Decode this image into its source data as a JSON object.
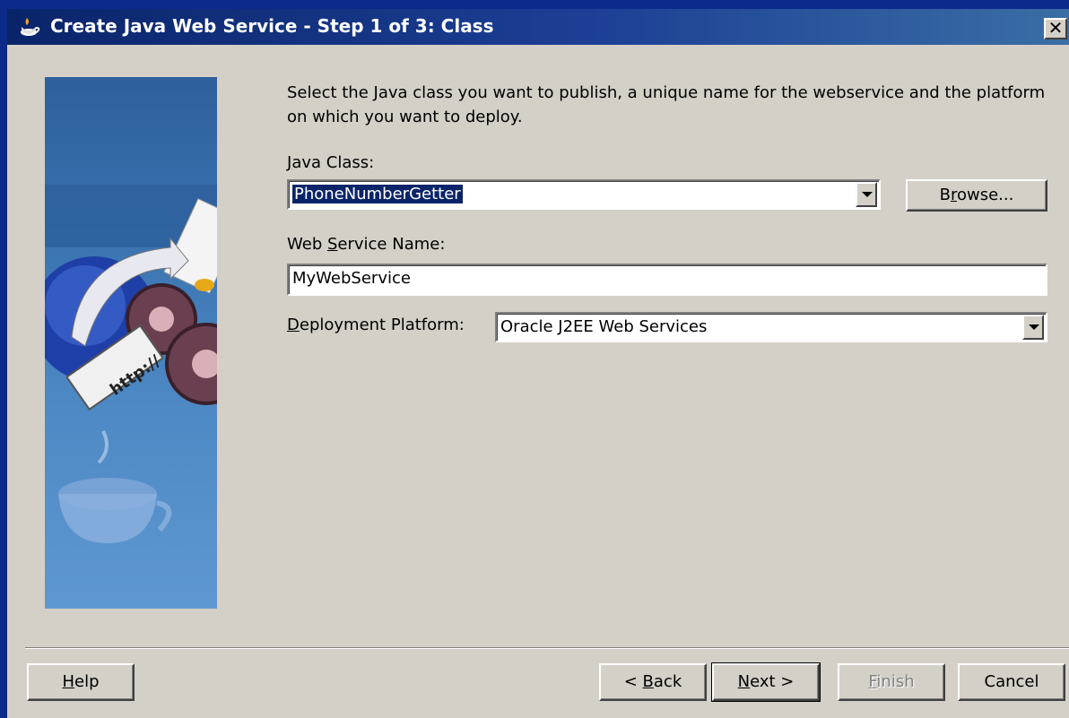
{
  "window": {
    "title": "Create Java Web Service - Step 1 of 3: Class",
    "close_glyph": "✕"
  },
  "intro_text": "Select the Java class you want to publish, a unique name for the webservice and the platform on which you want to deploy.",
  "java_class": {
    "label_mnemonic": "J",
    "label_rest": "ava Class:",
    "value": "PhoneNumberGetter",
    "browse_prefix": "B",
    "browse_mnemonic": "r",
    "browse_rest": "owse..."
  },
  "web_service_name": {
    "label_prefix": "Web ",
    "label_mnemonic": "S",
    "label_rest": "ervice Name:",
    "value": "MyWebService"
  },
  "deployment_platform": {
    "label_mnemonic": "D",
    "label_rest": "eployment Platform:",
    "value": "Oracle J2EE Web Services"
  },
  "footer": {
    "help_mnemonic": "H",
    "help_rest": "elp",
    "back_prefix": "< ",
    "back_mnemonic": "B",
    "back_rest": "ack",
    "next_mnemonic": "N",
    "next_rest": "ext >",
    "finish_mnemonic": "F",
    "finish_rest": "inish",
    "cancel_label": "Cancel"
  },
  "illustration": {
    "url_text": "http://"
  },
  "colors": {
    "titlebar_start": "#0a246a",
    "titlebar_end": "#3a6ea5",
    "dialog_face": "#d4d0c8",
    "selection": "#0a246a",
    "sidebar_blue": "#3a73b0"
  }
}
